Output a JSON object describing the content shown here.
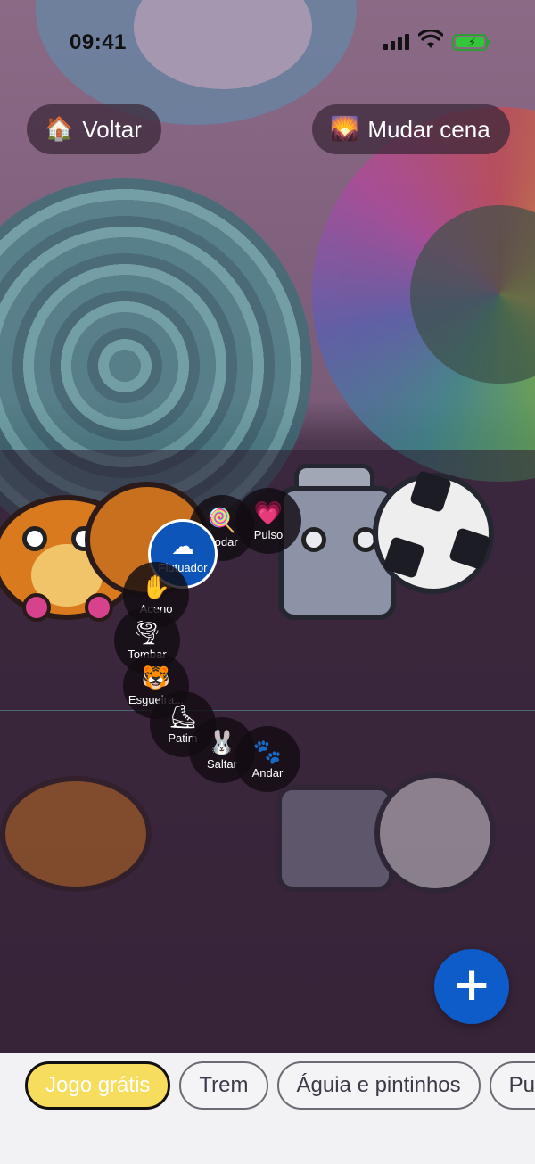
{
  "status_bar": {
    "time": "09:41"
  },
  "top_bar": {
    "back": {
      "icon": "🏠",
      "icon_name": "house-icon",
      "label": "Voltar"
    },
    "change_scene": {
      "icon": "🌄",
      "icon_name": "sunrise-scene-icon",
      "label": "Mudar cena"
    }
  },
  "action_menu": {
    "selected": "Flutuador",
    "items": [
      {
        "label": "Rodar",
        "icon": "🍭",
        "icon_name": "lollipop-icon"
      },
      {
        "label": "Pulso",
        "icon": "💗",
        "icon_name": "heart-icon"
      },
      {
        "label": "Flutuador",
        "icon": "☁",
        "icon_name": "cloud-icon"
      },
      {
        "label": "Aceno",
        "icon": "✋",
        "icon_name": "hand-icon"
      },
      {
        "label": "Tombar",
        "icon": "🌪",
        "icon_name": "tornado-icon"
      },
      {
        "label": "Esgueira...",
        "icon": "🐯",
        "icon_name": "tiger-icon"
      },
      {
        "label": "Patim",
        "icon": "⛸",
        "icon_name": "skate-icon"
      },
      {
        "label": "Saltar",
        "icon": "🐰",
        "icon_name": "rabbit-icon"
      },
      {
        "label": "Andar",
        "icon": "🐾",
        "icon_name": "feet-icon"
      }
    ]
  },
  "fab": {
    "icon": "+",
    "icon_name": "plus-icon"
  },
  "bottom_tabs": {
    "selected": "Jogo grátis",
    "items": [
      "Jogo grátis",
      "Trem",
      "Águia e pintinhos",
      "Pul"
    ]
  },
  "colors": {
    "accent_blue": "#0e5cc9",
    "selected_tab": "#f7dd5e",
    "active_action": "#0d55b8"
  }
}
